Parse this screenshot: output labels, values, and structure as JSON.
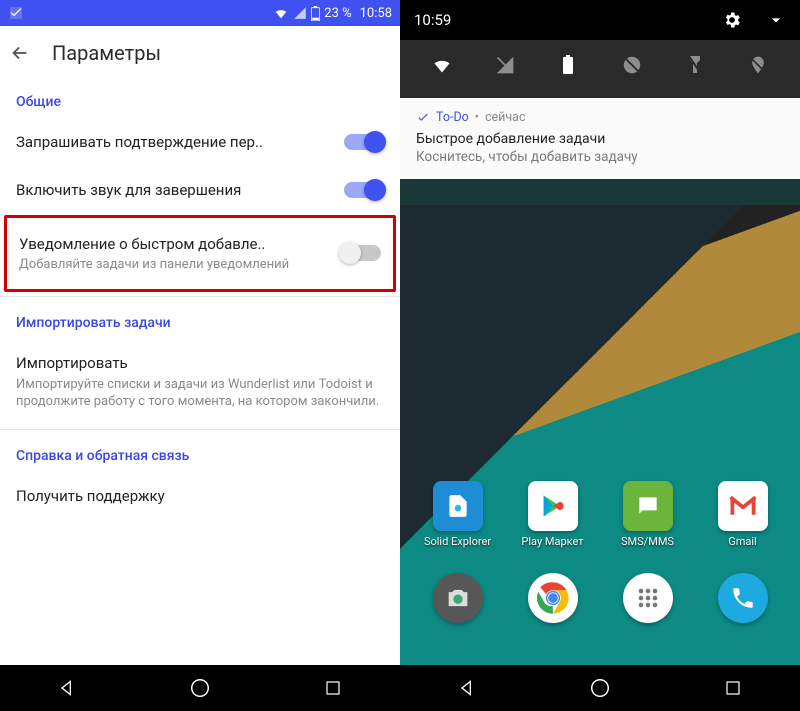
{
  "left": {
    "statusbar": {
      "battery": "23 %",
      "time": "10:58"
    },
    "appbar": {
      "title": "Параметры"
    },
    "sections": {
      "general": {
        "header": "Общие",
        "confirm": {
          "title": "Запрашивать подтверждение пер..",
          "on": true
        },
        "sound": {
          "title": "Включить звук для завершения",
          "on": true
        },
        "quickadd": {
          "title": "Уведомление о быстром добавле..",
          "sub": "Добавляйте задачи из панели уведомлений",
          "on": false
        }
      },
      "import": {
        "header": "Импортировать задачи",
        "item": {
          "title": "Импортировать",
          "sub": "Импортируйте списки и задачи из Wunderlist или Todoist и продолжите работу с того момента, на котором закончили."
        }
      },
      "help": {
        "header": "Справка и обратная связь",
        "support": {
          "title": "Получить поддержку"
        }
      }
    }
  },
  "right": {
    "statusbar": {
      "time": "10:59"
    },
    "notification": {
      "app": "To-Do",
      "when": "сейчас",
      "title": "Быстрое добавление задачи",
      "body": "Коснитесь, чтобы добавить задачу"
    },
    "apps": {
      "row1": [
        {
          "label": "Solid Explorer",
          "bg": "#1f8cd6"
        },
        {
          "label": "Play Маркет",
          "bg": "#ffffff"
        },
        {
          "label": "SMS/MMS",
          "bg": "#6bb53a"
        },
        {
          "label": "Gmail",
          "bg": "#ffffff"
        }
      ],
      "row2": [
        {
          "label": "",
          "bg": "#4a4a4a"
        },
        {
          "label": "",
          "bg": "#ffffff"
        },
        {
          "label": "",
          "bg": "#b9d24a"
        },
        {
          "label": "",
          "bg": "#1caae0"
        }
      ]
    }
  }
}
